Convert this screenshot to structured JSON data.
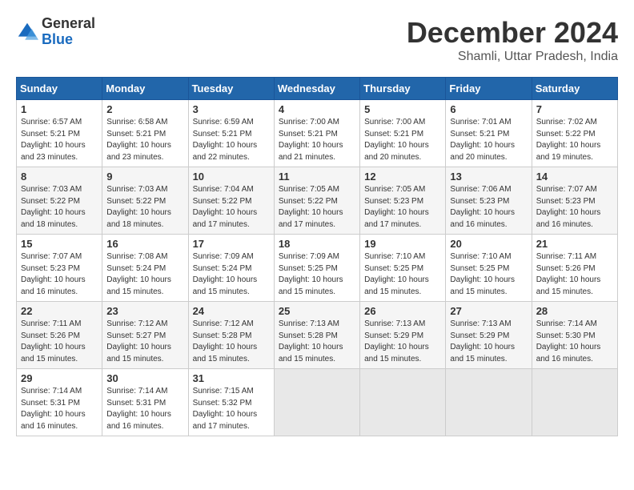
{
  "logo": {
    "general": "General",
    "blue": "Blue"
  },
  "title": "December 2024",
  "location": "Shamli, Uttar Pradesh, India",
  "days_header": [
    "Sunday",
    "Monday",
    "Tuesday",
    "Wednesday",
    "Thursday",
    "Friday",
    "Saturday"
  ],
  "weeks": [
    [
      {
        "day": "1",
        "info": "Sunrise: 6:57 AM\nSunset: 5:21 PM\nDaylight: 10 hours\nand 23 minutes."
      },
      {
        "day": "2",
        "info": "Sunrise: 6:58 AM\nSunset: 5:21 PM\nDaylight: 10 hours\nand 23 minutes."
      },
      {
        "day": "3",
        "info": "Sunrise: 6:59 AM\nSunset: 5:21 PM\nDaylight: 10 hours\nand 22 minutes."
      },
      {
        "day": "4",
        "info": "Sunrise: 7:00 AM\nSunset: 5:21 PM\nDaylight: 10 hours\nand 21 minutes."
      },
      {
        "day": "5",
        "info": "Sunrise: 7:00 AM\nSunset: 5:21 PM\nDaylight: 10 hours\nand 20 minutes."
      },
      {
        "day": "6",
        "info": "Sunrise: 7:01 AM\nSunset: 5:21 PM\nDaylight: 10 hours\nand 20 minutes."
      },
      {
        "day": "7",
        "info": "Sunrise: 7:02 AM\nSunset: 5:22 PM\nDaylight: 10 hours\nand 19 minutes."
      }
    ],
    [
      {
        "day": "8",
        "info": "Sunrise: 7:03 AM\nSunset: 5:22 PM\nDaylight: 10 hours\nand 18 minutes."
      },
      {
        "day": "9",
        "info": "Sunrise: 7:03 AM\nSunset: 5:22 PM\nDaylight: 10 hours\nand 18 minutes."
      },
      {
        "day": "10",
        "info": "Sunrise: 7:04 AM\nSunset: 5:22 PM\nDaylight: 10 hours\nand 17 minutes."
      },
      {
        "day": "11",
        "info": "Sunrise: 7:05 AM\nSunset: 5:22 PM\nDaylight: 10 hours\nand 17 minutes."
      },
      {
        "day": "12",
        "info": "Sunrise: 7:05 AM\nSunset: 5:23 PM\nDaylight: 10 hours\nand 17 minutes."
      },
      {
        "day": "13",
        "info": "Sunrise: 7:06 AM\nSunset: 5:23 PM\nDaylight: 10 hours\nand 16 minutes."
      },
      {
        "day": "14",
        "info": "Sunrise: 7:07 AM\nSunset: 5:23 PM\nDaylight: 10 hours\nand 16 minutes."
      }
    ],
    [
      {
        "day": "15",
        "info": "Sunrise: 7:07 AM\nSunset: 5:23 PM\nDaylight: 10 hours\nand 16 minutes."
      },
      {
        "day": "16",
        "info": "Sunrise: 7:08 AM\nSunset: 5:24 PM\nDaylight: 10 hours\nand 15 minutes."
      },
      {
        "day": "17",
        "info": "Sunrise: 7:09 AM\nSunset: 5:24 PM\nDaylight: 10 hours\nand 15 minutes."
      },
      {
        "day": "18",
        "info": "Sunrise: 7:09 AM\nSunset: 5:25 PM\nDaylight: 10 hours\nand 15 minutes."
      },
      {
        "day": "19",
        "info": "Sunrise: 7:10 AM\nSunset: 5:25 PM\nDaylight: 10 hours\nand 15 minutes."
      },
      {
        "day": "20",
        "info": "Sunrise: 7:10 AM\nSunset: 5:25 PM\nDaylight: 10 hours\nand 15 minutes."
      },
      {
        "day": "21",
        "info": "Sunrise: 7:11 AM\nSunset: 5:26 PM\nDaylight: 10 hours\nand 15 minutes."
      }
    ],
    [
      {
        "day": "22",
        "info": "Sunrise: 7:11 AM\nSunset: 5:26 PM\nDaylight: 10 hours\nand 15 minutes."
      },
      {
        "day": "23",
        "info": "Sunrise: 7:12 AM\nSunset: 5:27 PM\nDaylight: 10 hours\nand 15 minutes."
      },
      {
        "day": "24",
        "info": "Sunrise: 7:12 AM\nSunset: 5:28 PM\nDaylight: 10 hours\nand 15 minutes."
      },
      {
        "day": "25",
        "info": "Sunrise: 7:13 AM\nSunset: 5:28 PM\nDaylight: 10 hours\nand 15 minutes."
      },
      {
        "day": "26",
        "info": "Sunrise: 7:13 AM\nSunset: 5:29 PM\nDaylight: 10 hours\nand 15 minutes."
      },
      {
        "day": "27",
        "info": "Sunrise: 7:13 AM\nSunset: 5:29 PM\nDaylight: 10 hours\nand 15 minutes."
      },
      {
        "day": "28",
        "info": "Sunrise: 7:14 AM\nSunset: 5:30 PM\nDaylight: 10 hours\nand 16 minutes."
      }
    ],
    [
      {
        "day": "29",
        "info": "Sunrise: 7:14 AM\nSunset: 5:31 PM\nDaylight: 10 hours\nand 16 minutes."
      },
      {
        "day": "30",
        "info": "Sunrise: 7:14 AM\nSunset: 5:31 PM\nDaylight: 10 hours\nand 16 minutes."
      },
      {
        "day": "31",
        "info": "Sunrise: 7:15 AM\nSunset: 5:32 PM\nDaylight: 10 hours\nand 17 minutes."
      },
      {
        "day": "",
        "info": ""
      },
      {
        "day": "",
        "info": ""
      },
      {
        "day": "",
        "info": ""
      },
      {
        "day": "",
        "info": ""
      }
    ]
  ]
}
